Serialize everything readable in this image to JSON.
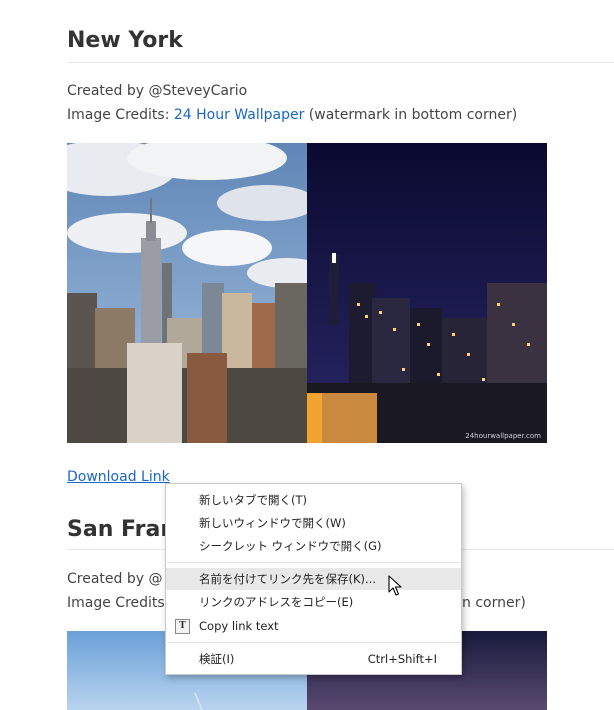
{
  "section1": {
    "title": "New York",
    "created_by": "Created by @SteveyCario",
    "credits_prefix": "Image Credits: ",
    "credits_link": "24 Hour Wallpaper",
    "credits_suffix": " (watermark in bottom corner)",
    "watermark": "24hourwallpaper.com",
    "download_link": "Download Link"
  },
  "section2": {
    "title_visible": "San Franc",
    "created_by_visible": "Created by @",
    "credits_visible": "Image Credits",
    "credits_tail_visible": "n corner)"
  },
  "context_menu": {
    "items": [
      {
        "label": "新しいタブで開く(T)",
        "shortcut": ""
      },
      {
        "label": "新しいウィンドウで開く(W)",
        "shortcut": ""
      },
      {
        "label": "シークレット ウィンドウで開く(G)",
        "shortcut": ""
      },
      {
        "label": "名前を付けてリンク先を保存(K)...",
        "shortcut": ""
      },
      {
        "label": "リンクのアドレスをコピー(E)",
        "shortcut": ""
      },
      {
        "label": "Copy link text",
        "shortcut": "",
        "icon": "text-icon",
        "icon_glyph": "T"
      },
      {
        "label": "検証(I)",
        "shortcut": "Ctrl+Shift+I"
      }
    ],
    "highlighted_index": 3
  },
  "colors": {
    "link": "#1a66c7",
    "menu_highlight": "#e8e8e8",
    "day_sky": "#7fa6cf",
    "night_sky": "#0f0f3a"
  }
}
